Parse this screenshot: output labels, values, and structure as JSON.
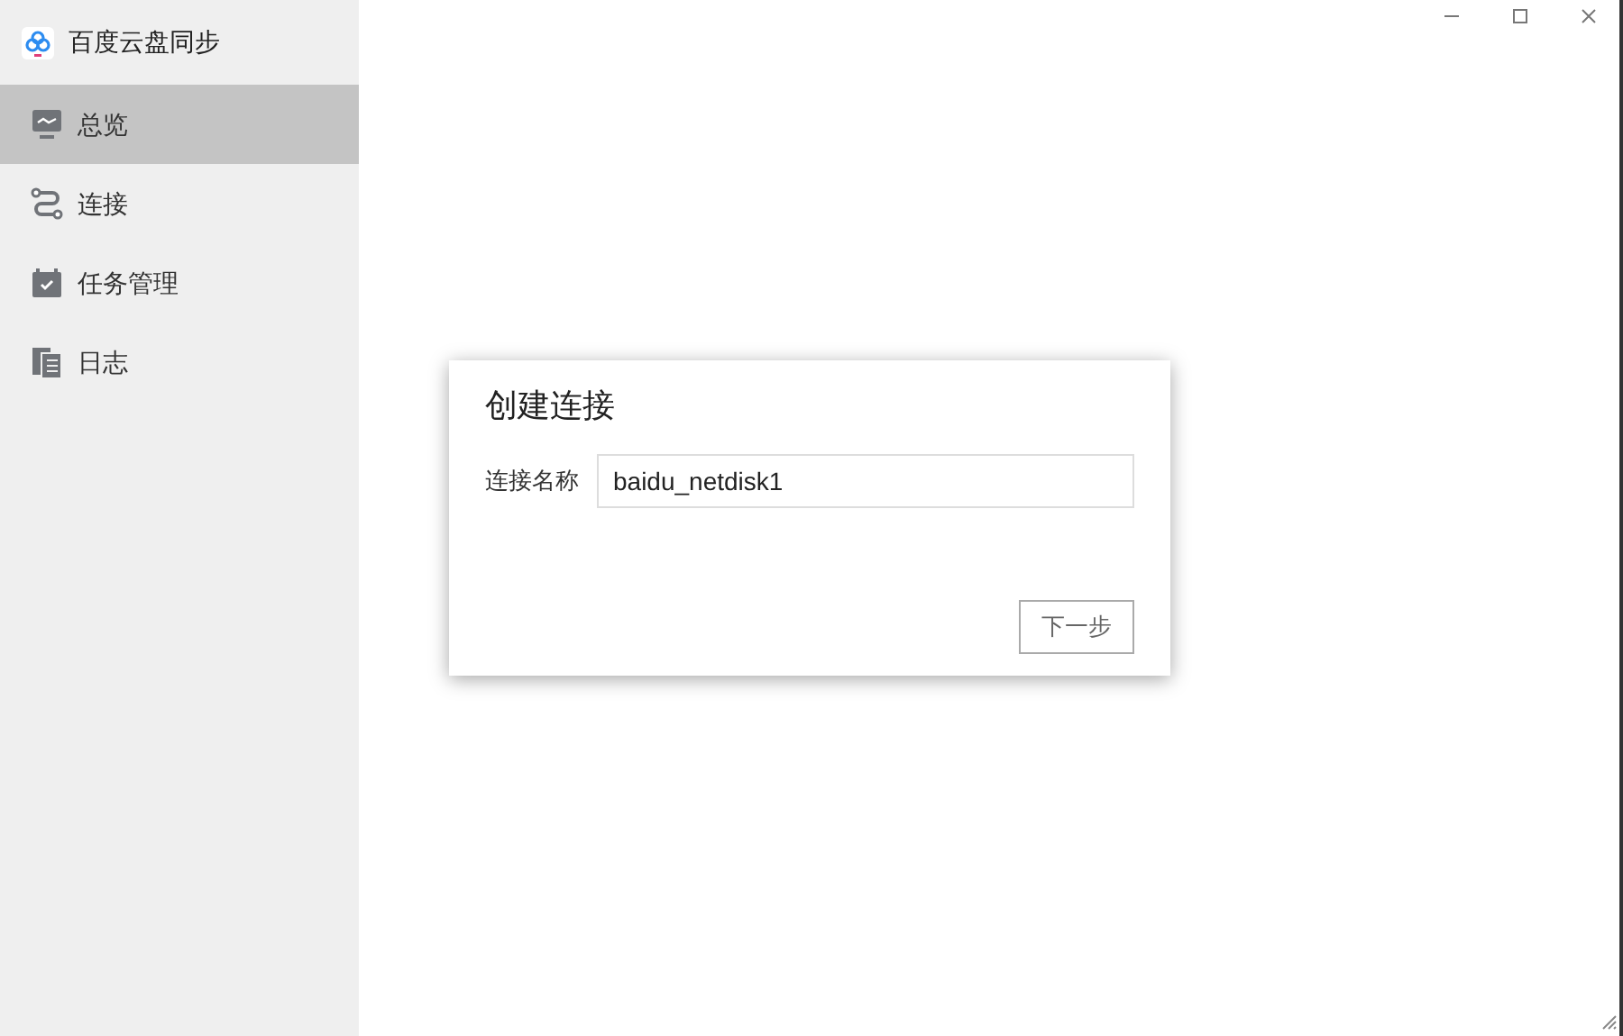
{
  "app": {
    "title": "百度云盘同步"
  },
  "sidebar": {
    "items": [
      {
        "label": "总览",
        "selected": true
      },
      {
        "label": "连接",
        "selected": false
      },
      {
        "label": "任务管理",
        "selected": false
      },
      {
        "label": "日志",
        "selected": false
      }
    ]
  },
  "dialog": {
    "title": "创建连接",
    "field": {
      "label": "连接名称",
      "value": "baidu_netdisk1"
    },
    "button": "下一步"
  }
}
